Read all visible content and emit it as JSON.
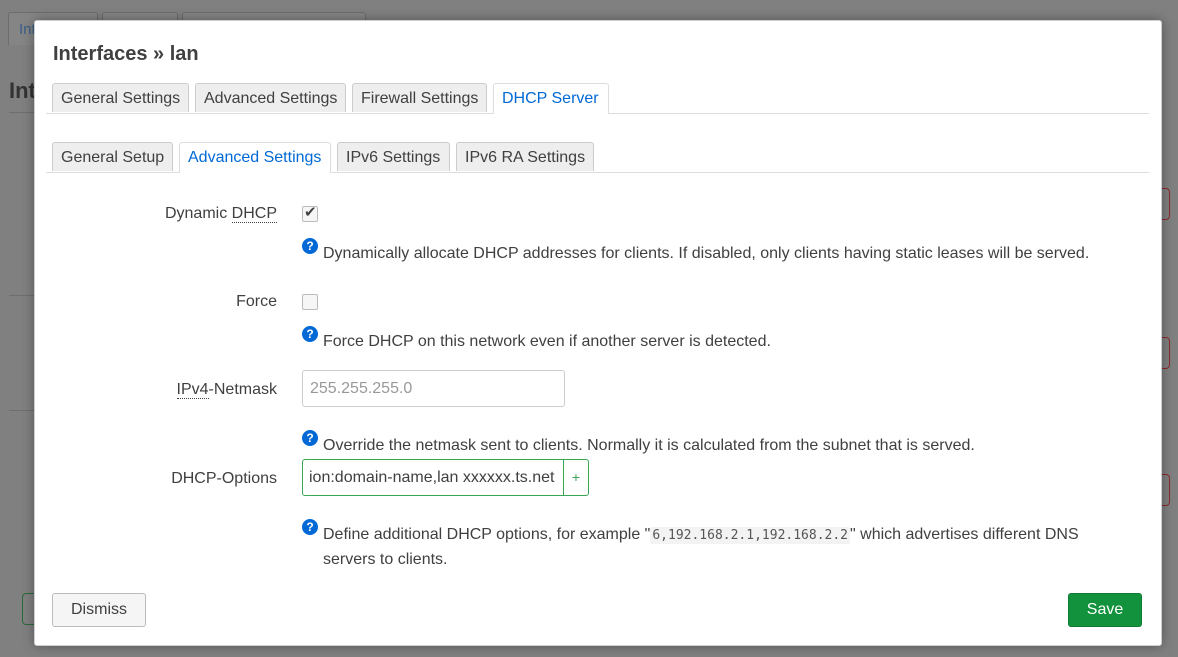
{
  "background": {
    "tab_fragment": "Int",
    "heading_fragment": "Int"
  },
  "modal": {
    "title": "Interfaces » lan",
    "main_tabs": [
      {
        "label": "General Settings",
        "active": false
      },
      {
        "label": "Advanced Settings",
        "active": false
      },
      {
        "label": "Firewall Settings",
        "active": false
      },
      {
        "label": "DHCP Server",
        "active": true
      }
    ],
    "sub_tabs": [
      {
        "label": "General Setup",
        "active": false
      },
      {
        "label": "Advanced Settings",
        "active": true
      },
      {
        "label": "IPv6 Settings",
        "active": false
      },
      {
        "label": "IPv6 RA Settings",
        "active": false
      }
    ],
    "fields": {
      "dynamic_dhcp": {
        "label_prefix": "Dynamic ",
        "label_abbr": "DHCP",
        "checked": true,
        "help": "Dynamically allocate DHCP addresses for clients. If disabled, only clients having static leases will be served."
      },
      "force": {
        "label": "Force",
        "checked": false,
        "help": "Force DHCP on this network even if another server is detected."
      },
      "ipv4_netmask": {
        "label_abbr": "IPv4",
        "label_suffix": "-Netmask",
        "placeholder": "255.255.255.0",
        "value": "",
        "help": "Override the netmask sent to clients. Normally it is calculated from the subnet that is served."
      },
      "dhcp_options": {
        "label": "DHCP-Options",
        "value": "ion:domain-name,lan xxxxxx.ts.net",
        "add_symbol": "+",
        "help_before": "Define additional DHCP options, for example \"",
        "help_code": "6,192.168.2.1,192.168.2.2",
        "help_after": "\" which advertises different DNS",
        "help_line2": "servers to clients."
      }
    },
    "help_icon_glyph": "?",
    "buttons": {
      "dismiss": "Dismiss",
      "save": "Save"
    }
  },
  "colors": {
    "accent": "#0069d6",
    "save": "#12923c",
    "focus": "#3aa655"
  }
}
